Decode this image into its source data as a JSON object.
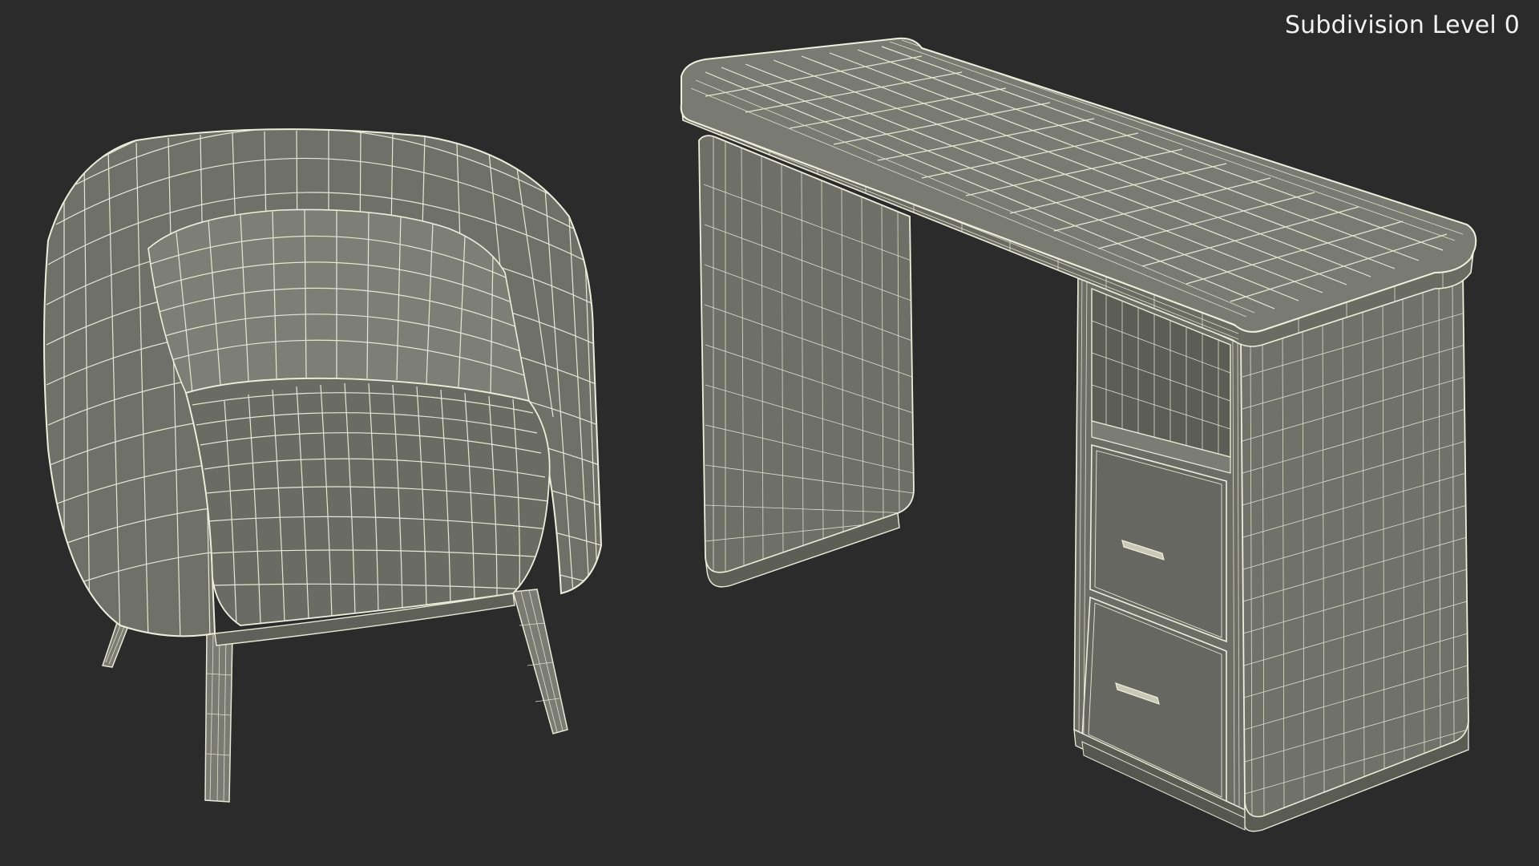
{
  "viewport": {
    "subdivision_label": "Subdivision Level 0",
    "background_color": "#2b2b2b",
    "mesh_fill_color": "#75766c",
    "mesh_dark_color": "#5d5e56",
    "wire_color": "#e8e8d6"
  },
  "objects": [
    {
      "name": "armchair",
      "type": "3d-model"
    },
    {
      "name": "desk",
      "type": "3d-model"
    }
  ]
}
